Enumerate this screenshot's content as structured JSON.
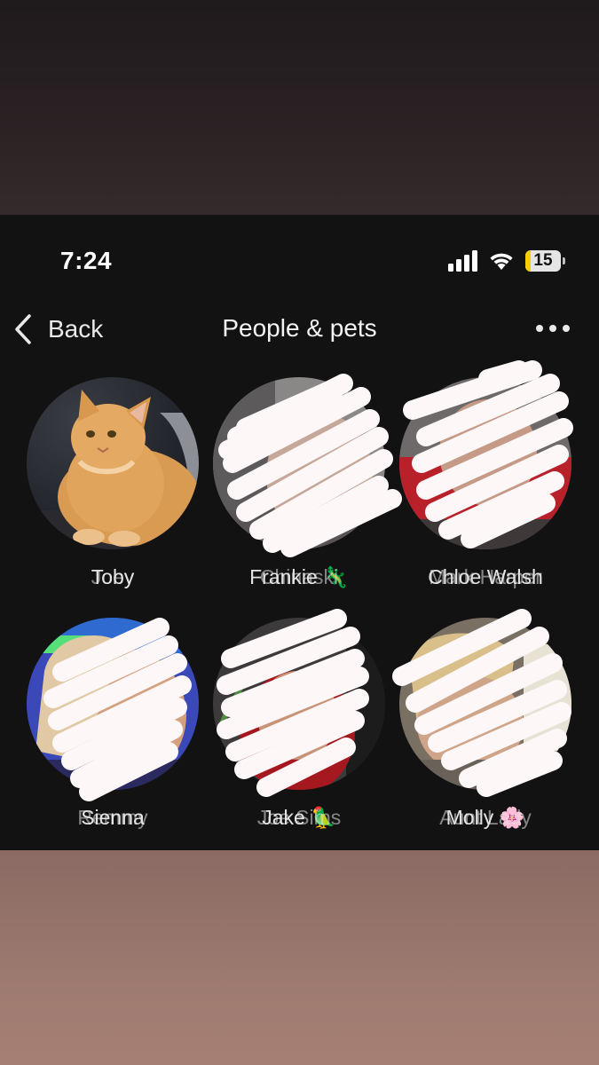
{
  "status_bar": {
    "time": "7:24",
    "battery_level": "15",
    "battery_fraction": 0.15
  },
  "header": {
    "back_label": "Back",
    "title": "People & pets",
    "more_icon": "more-horizontal-icon"
  },
  "people": [
    {
      "name": "Toby",
      "name_overlap": "Joey",
      "avatar": "orange-cat-photo"
    },
    {
      "name": "Frankie 🦎",
      "name_overlap": "Chinaski",
      "avatar": "redacted-photo"
    },
    {
      "name": "Chloe Walsh",
      "name_overlap": "Mark Harper",
      "avatar": "redacted-photo"
    },
    {
      "name": "Sienna",
      "name_overlap": "Remmy",
      "avatar": "redacted-photo"
    },
    {
      "name": "Jake 🦜",
      "name_overlap": "Joe Sims",
      "avatar": "redacted-photo"
    },
    {
      "name": "Molly 🌸",
      "name_overlap": "Aunt Lady",
      "avatar": "redacted-photo"
    }
  ],
  "colors": {
    "background": "#121212",
    "text": "#f1f1f1",
    "battery_accent": "#f5d000",
    "scribble": "#fdf7f8"
  }
}
